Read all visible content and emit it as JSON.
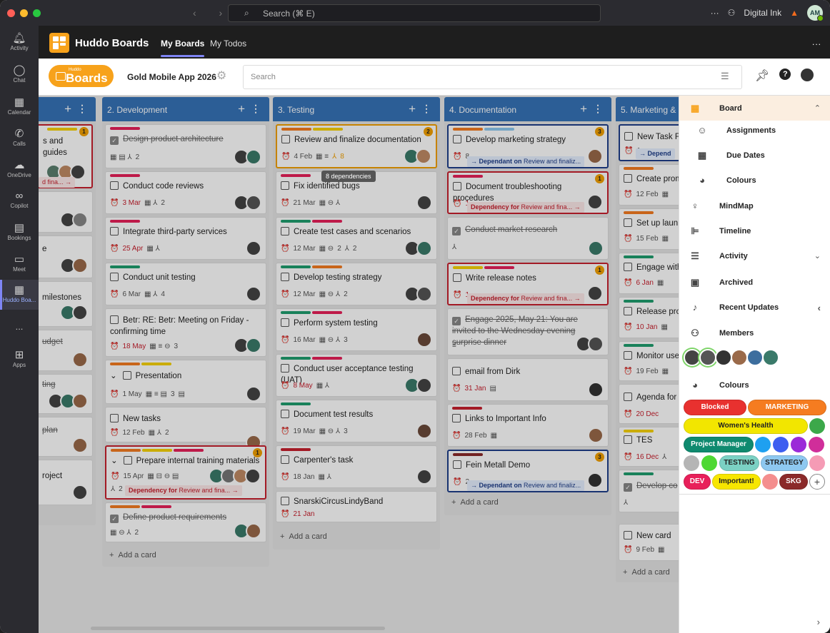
{
  "titlebar": {
    "search_placeholder": "Search (⌘ E)",
    "org": "Digital Ink",
    "user_initials": "AM"
  },
  "rail": [
    {
      "label": "Activity"
    },
    {
      "label": "Chat"
    },
    {
      "label": "Calendar"
    },
    {
      "label": "Calls"
    },
    {
      "label": "OneDrive"
    },
    {
      "label": "Copilot"
    },
    {
      "label": "Bookings"
    },
    {
      "label": "Meet"
    },
    {
      "label": "Huddo Boa..."
    },
    {
      "label": "..."
    },
    {
      "label": "Apps"
    }
  ],
  "app": {
    "title": "Huddo Boards",
    "tabs": [
      "My Boards",
      "My Todos"
    ],
    "more": "..."
  },
  "toolbar": {
    "logo_small": "Huddo",
    "logo_big": "Boards",
    "board_name": "Gold Mobile App 2026",
    "search_placeholder": "Search"
  },
  "columns": {
    "c1": {
      "cards": [
        "s and guides",
        "d fina...",
        "milestones",
        "udget",
        "ting",
        "plan",
        "roject"
      ],
      "badge": "1"
    },
    "c2": {
      "title": "2. Development",
      "cards": [
        {
          "title": "Design product architecture",
          "meta": "2"
        },
        {
          "title": "Conduct code reviews",
          "date": "3 Mar",
          "meta": "2"
        },
        {
          "title": "Integrate third-party services",
          "date": "25 Apr"
        },
        {
          "title": "Conduct unit testing",
          "date": "6 Mar",
          "meta": "4"
        },
        {
          "title": "Betr: RE: Betr: Meeting on Friday - confirming time",
          "date": "18 May",
          "meta": "3"
        },
        {
          "title": "Presentation",
          "date": "1 May",
          "meta": "3"
        },
        {
          "title": "New tasks",
          "date": "12 Feb",
          "meta": "2"
        },
        {
          "title": "Prepare internal training materials",
          "date": "15 Apr",
          "meta": "2",
          "dep": "Review and fina...",
          "badge": "1"
        },
        {
          "title": "Define product requirements",
          "meta": "2"
        }
      ],
      "add": "Add a card"
    },
    "c3": {
      "title": "3. Testing",
      "cards": [
        {
          "title": "Review and finalize documentation",
          "date": "4 Feb",
          "meta": "8",
          "badge": "2"
        },
        {
          "title": "Fix identified bugs",
          "date": "21 Mar"
        },
        {
          "title": "Create test cases and scenarios",
          "date": "12 Mar",
          "meta": "2",
          "meta2": "2"
        },
        {
          "title": "Develop testing strategy",
          "date": "12 Mar",
          "meta": "2"
        },
        {
          "title": "Perform system testing",
          "date": "16 Mar",
          "meta": "3"
        },
        {
          "title": "Conduct user acceptance testing (UAT)",
          "date": "8 May"
        },
        {
          "title": "Document test results",
          "date": "19 Mar",
          "meta": "3"
        },
        {
          "title": "Carpenter's task",
          "date": "18 Jan"
        },
        {
          "title": "SnarskiCircusLindyBand",
          "date": "21 Jan"
        }
      ],
      "tooltip": "8 dependencies",
      "add": "Add a card"
    },
    "c4": {
      "title": "4. Documentation",
      "cards": [
        {
          "title": "Develop marketing strategy",
          "date": "8",
          "dep": "Review and finaliz...",
          "badge": "3"
        },
        {
          "title": "Document troubleshooting procedures",
          "date": "1",
          "dep": "Review and fina...",
          "badge": "1"
        },
        {
          "title": "Conduct market research"
        },
        {
          "title": "Write release notes",
          "date": "1",
          "dep": "Review and fina...",
          "badge": "1"
        },
        {
          "title": "Engage 2025, May 21: You are invited to the Wednesday evening surprise dinner"
        },
        {
          "title": "email from Dirk",
          "date": "31 Jan"
        },
        {
          "title": "Links to Important Info",
          "date": "28 Feb"
        },
        {
          "title": "Fein Metall Demo",
          "date": "2",
          "dep": "Review and finaliz...",
          "badge": "3"
        }
      ],
      "add": "Add a card"
    },
    "c5": {
      "title": "5. Marketing &",
      "cards": [
        {
          "title": "New Task F",
          "date": "1",
          "dep": "Depend"
        },
        {
          "title": "Create prom",
          "date": "12 Feb"
        },
        {
          "title": "Set up laun",
          "date": "15 Feb"
        },
        {
          "title": "Engage with",
          "date": "6 Jan"
        },
        {
          "title": "Release pro",
          "date": "10 Jan"
        },
        {
          "title": "Monitor use",
          "date": "19 Feb"
        },
        {
          "title": "Agenda for",
          "date": "20 Dec"
        },
        {
          "title": "TES",
          "date": "16 Dec"
        },
        {
          "title": "Develop co"
        },
        {
          "title": "New card",
          "date": "9 Feb"
        }
      ],
      "add": "Add a card"
    }
  },
  "dep_labels": {
    "for_prefix": "Dependency for",
    "on_prefix": "Dependant on"
  },
  "panel": {
    "items": [
      "Board",
      "Assignments",
      "Due Dates",
      "Colours",
      "MindMap",
      "Timeline",
      "Activity",
      "Archived",
      "Recent Updates",
      "Members",
      "Colours"
    ],
    "pills": [
      "Blocked",
      "MARKETING",
      "Women's Health",
      "Project Manager",
      "TESTING",
      "STRATEGY",
      "DEV",
      "Important!",
      "SKG"
    ],
    "colors": {
      "blocked": "#e8312f",
      "marketing": "#f57c20",
      "womens": "#f2e600",
      "pm": "#0f8a6f",
      "testing": "#7bd1c4",
      "strategy": "#8ec8f0",
      "dev": "#e8205a",
      "important": "#f7e600",
      "skg": "#8b2a2a"
    }
  },
  "theme": {
    "accent": "#3673b8",
    "orange": "#f7a21b",
    "red": "#c7202e",
    "navy": "#1f3f8a"
  }
}
